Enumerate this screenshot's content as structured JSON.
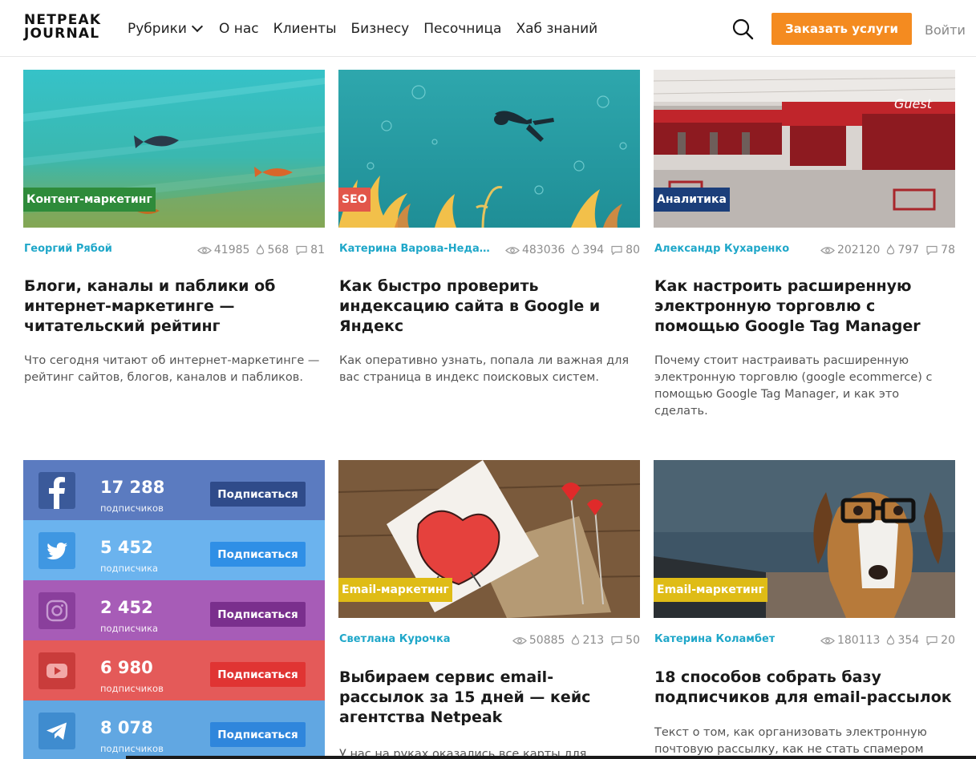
{
  "header": {
    "logo_line1": "NETPEAK",
    "logo_line2": "JOURNAL",
    "nav": [
      "Рубрики",
      "О нас",
      "Клиенты",
      "Бизнесу",
      "Песочница",
      "Хаб знаний"
    ],
    "order_button": "Заказать услуги",
    "login": "Войти",
    "accent_color": "#f48b20"
  },
  "articles": [
    {
      "category": "Контент-маркетинг",
      "author": "Георгий Рябой",
      "views": "41985",
      "likes": "568",
      "comments": "81",
      "title": "Блоги, каналы и паблики об интернет-маркетинге — читательский рейтинг",
      "excerpt": "Что сегодня читают об интернет-маркетинге — рейтинг сайтов, блогов, каналов и пабликов."
    },
    {
      "category": "SEO",
      "author": "Катерина Варова-Недашковская",
      "views": "483036",
      "likes": "394",
      "comments": "80",
      "title": "Как быстро проверить индексацию сайта в Google и Яндекс",
      "excerpt": "Как оперативно узнать, попала ли важная для вас страница в индекс поисковых систем."
    },
    {
      "category": "Аналитика",
      "author": "Александр Кухаренко",
      "views": "202120",
      "likes": "797",
      "comments": "78",
      "title": "Как настроить расширенную электронную торговлю с помощью Google Tag Manager",
      "excerpt": "Почему стоит настраивать расширенную электронную торговлю (google ecommerce) с помощью Google Tag Manager, и как это сделать."
    },
    {
      "category": "Email-маркетинг",
      "author": "Светлана Курочка",
      "views": "50885",
      "likes": "213",
      "comments": "50",
      "title": "Выбираем сервис email-рассылок за 15 дней — кейс агентства Netpeak",
      "excerpt": "У нас на руках оказались все карты для"
    },
    {
      "category": "Email-маркетинг",
      "author": "Катерина Коламбет",
      "views": "180113",
      "likes": "354",
      "comments": "20",
      "title": "18 способов собрать базу подписчиков для email-рассылок",
      "excerpt": "Текст о том, как организовать электронную почтовую рассылку, как не стать спамером"
    }
  ],
  "social": [
    {
      "network": "facebook-icon",
      "count": "17 288",
      "label": "подписчиков",
      "button": "Подписаться",
      "bg": "#5b7bc0",
      "icon_bg": "#3b5a9a",
      "btn_bg": "#2f4b8a"
    },
    {
      "network": "twitter-icon",
      "count": "5 452",
      "label": "подписчика",
      "button": "Подписаться",
      "bg": "#6bb3ee",
      "icon_bg": "#3f97e2",
      "btn_bg": "#2f8fe6"
    },
    {
      "network": "instagram-icon",
      "count": "2 452",
      "label": "подписчика",
      "button": "Подписаться",
      "bg": "#a75cb7",
      "icon_bg": "#8a3f9c",
      "btn_bg": "#7a2f8d"
    },
    {
      "network": "youtube-icon",
      "count": "6 980",
      "label": "подписчиков",
      "button": "Подписаться",
      "bg": "#e45a59",
      "icon_bg": "#c93c3b",
      "btn_bg": "#e03433"
    },
    {
      "network": "telegram-icon",
      "count": "8 078",
      "label": "подписчиков",
      "button": "Подписаться",
      "bg": "#61a7e2",
      "icon_bg": "#3f8ccf",
      "btn_bg": "#2f86dc"
    }
  ]
}
